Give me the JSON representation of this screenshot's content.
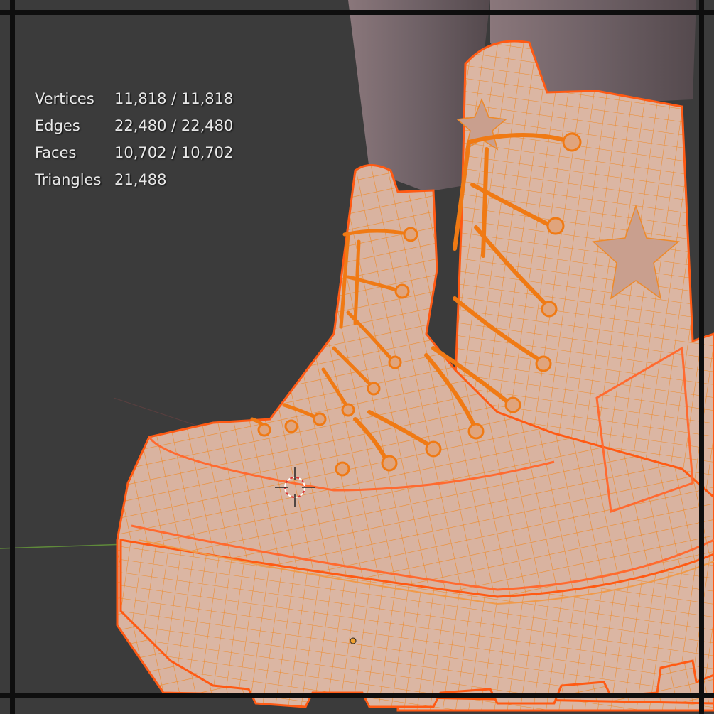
{
  "viewport": {
    "stats": [
      {
        "label": "Vertices",
        "value": "11,818 / 11,818"
      },
      {
        "label": "Edges",
        "value": "22,480 / 22,480"
      },
      {
        "label": "Faces",
        "value": "10,702 / 10,702"
      },
      {
        "label": "Triangles",
        "value": "21,488"
      }
    ]
  },
  "colors": {
    "background": "#3b3b3b",
    "mesh_fill": "#d9b3a0",
    "wire": "#f08a1e",
    "outline": "#ff5a14",
    "leg": "#7a6a6e"
  },
  "icons": [
    "3d-cursor-icon",
    "origin-point-icon"
  ]
}
